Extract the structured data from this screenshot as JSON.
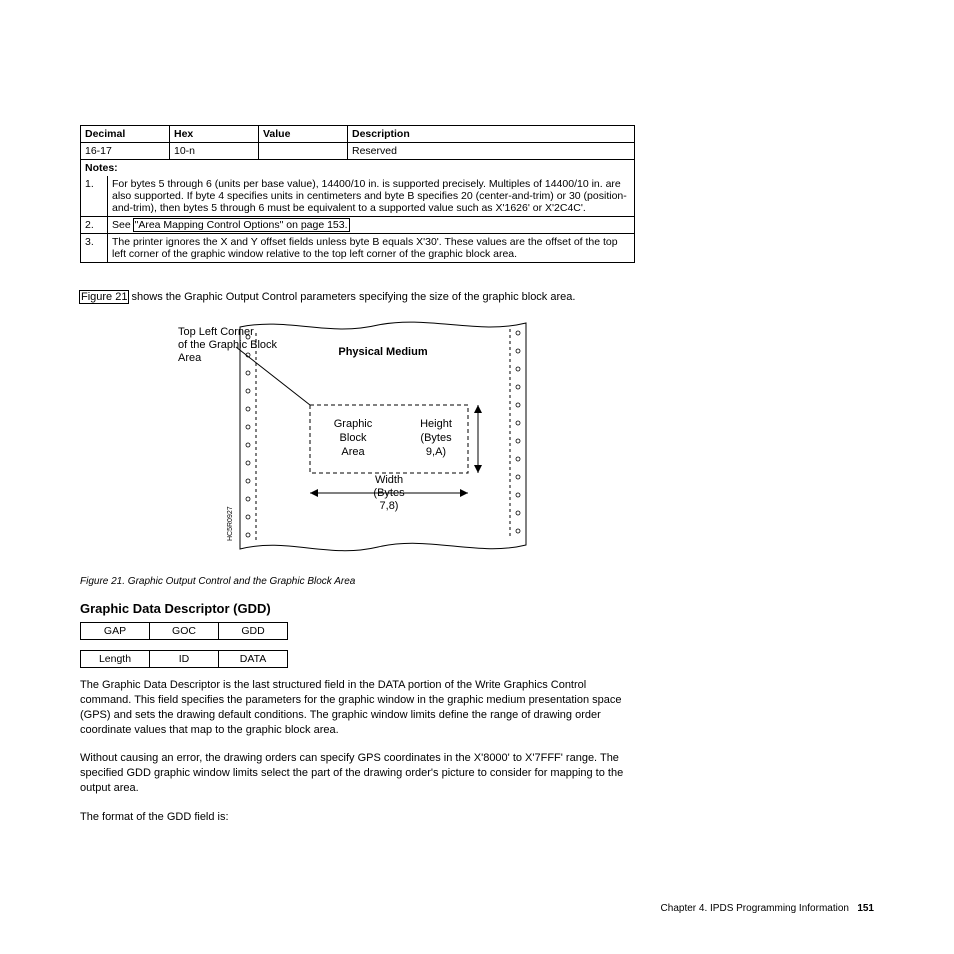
{
  "table": {
    "headers": [
      "Decimal",
      "Hex",
      "Value",
      "Description"
    ],
    "row": {
      "decimal": "16-17",
      "hex": "10-n",
      "value": "",
      "description": "Reserved"
    }
  },
  "notes": {
    "title": "Notes:",
    "items": [
      {
        "num": "1.",
        "text": "For bytes 5 through 6 (units per base value), 14400/10 in. is supported precisely. Multiples of 14400/10 in. are also supported. If byte 4 specifies units in centimeters and byte B specifies 20 (center-and-trim) or 30 (position-and-trim), then bytes 5 through 6 must be equivalent to a supported value such as X'1626' or X'2C4C'."
      },
      {
        "num": "2.",
        "see": "See ",
        "link": "\"Area Mapping Control Options\" on page 153."
      },
      {
        "num": "3.",
        "text": "The printer ignores the X and Y offset fields unless byte B equals X'30'. These values are the offset of the top left corner of the graphic window relative to the top left corner of the graphic block area."
      }
    ]
  },
  "preamble": {
    "link": "Figure 21",
    "rest": " shows the Graphic Output Control parameters specifying the size of the graphic block area."
  },
  "figure": {
    "label_tl1": "Top Left Corner",
    "label_tl2": "of the Graphic Block",
    "label_tl3": "Area",
    "phys": "Physical Medium",
    "gb1": "Graphic",
    "gb2": "Block",
    "gb3": "Area",
    "h1": "Height",
    "h2": "(Bytes",
    "h3": "9,A)",
    "w1": "Width",
    "w2": "(Bytes",
    "w3": "7,8)",
    "code": "HC5R0927"
  },
  "caption": "Figure 21. Graphic Output Control and the Graphic Block Area",
  "section_title": "Graphic Data Descriptor (GDD)",
  "small_top": [
    "GAP",
    "GOC",
    "GDD"
  ],
  "small_bot": [
    "Length",
    "ID",
    "DATA"
  ],
  "p1": "The Graphic Data Descriptor is the last structured field in the DATA portion of the Write Graphics Control command. This field specifies the parameters for the graphic window in the graphic medium presentation space (GPS) and sets the drawing default conditions. The graphic window limits define the range of drawing order coordinate values that map to the graphic block area.",
  "p2": "Without causing an error, the drawing orders can specify GPS coordinates in the X'8000' to X'7FFF' range. The specified GDD graphic window limits select the part of the drawing order's picture to consider for mapping to the output area.",
  "p3": "The format of the GDD field is:",
  "footer": {
    "chapter": "Chapter 4. IPDS Programming Information",
    "page": "151"
  }
}
